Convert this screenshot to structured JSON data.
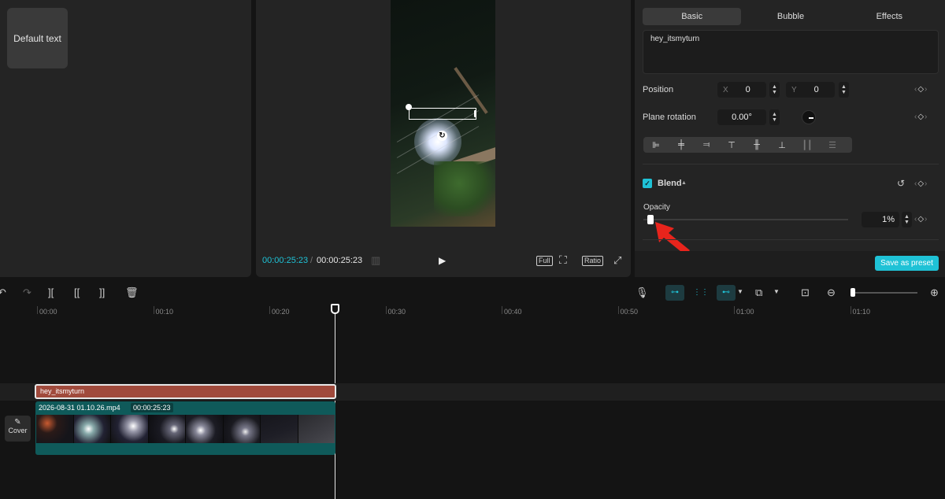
{
  "media_panel": {
    "text_preset_label": "Default text"
  },
  "player": {
    "current_time": "00:00:25:23",
    "separator": "/",
    "total_time": "00:00:25:23",
    "full_label": "Full",
    "ratio_label": "Ratio"
  },
  "inspector": {
    "tabs": [
      "Basic",
      "Bubble",
      "Effects"
    ],
    "active_tab": "Basic",
    "text_content": "hey_itsmyturn",
    "position": {
      "label": "Position",
      "x_label": "X",
      "x_value": "0",
      "y_label": "Y",
      "y_value": "0"
    },
    "plane_rotation": {
      "label": "Plane rotation",
      "value": "0.00°"
    },
    "blend": {
      "label": "Blend",
      "checked": true
    },
    "opacity": {
      "label": "Opacity",
      "value": "1%",
      "level_percent": 1
    },
    "save_preset_label": "Save as preset",
    "accent_color": "#1fc2d6"
  },
  "timeline": {
    "ruler_labels": [
      "00:00",
      "00:10",
      "00:20",
      "00:30",
      "00:40",
      "00:50",
      "01:00",
      "01:10"
    ],
    "text_clip_label": "hey_itsmyturn",
    "video_clip_name": "2026-08-31 01.10.26.mp4",
    "video_clip_duration": "00:00:25:23",
    "cover_label": "Cover"
  }
}
